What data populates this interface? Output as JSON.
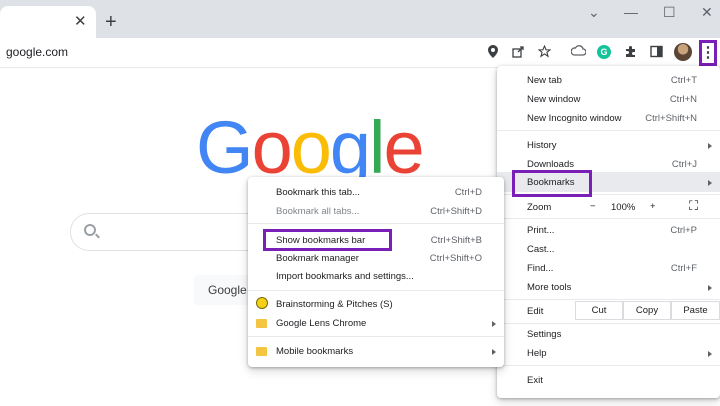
{
  "window": {
    "tab_close": "✕",
    "new_tab": "+",
    "controls": {
      "dropdown": "⌄",
      "minimize": "—",
      "maximize": "☐",
      "close": "✕"
    }
  },
  "toolbar": {
    "url": "google.com",
    "icons": [
      "location-icon",
      "share-icon",
      "star-icon",
      "extension-cloud-icon",
      "grammarly-icon",
      "puzzle-icon",
      "sidepanel-icon",
      "avatar",
      "kebab-menu-icon"
    ],
    "grammarly_letter": "G",
    "kebab": "⋮"
  },
  "google": {
    "logo_letters": [
      "G",
      "o",
      "o",
      "g",
      "l",
      "e"
    ],
    "logo_colors": [
      "#4285F4",
      "#EA4335",
      "#FBBC05",
      "#4285F4",
      "#34A853",
      "#EA4335"
    ],
    "search_button": "Google"
  },
  "chrome_menu": {
    "new_tab": {
      "label": "New tab",
      "shortcut": "Ctrl+T"
    },
    "new_window": {
      "label": "New window",
      "shortcut": "Ctrl+N"
    },
    "incognito": {
      "label": "New Incognito window",
      "shortcut": "Ctrl+Shift+N"
    },
    "history": {
      "label": "History"
    },
    "downloads": {
      "label": "Downloads",
      "shortcut": "Ctrl+J"
    },
    "bookmarks": {
      "label": "Bookmarks"
    },
    "zoom": {
      "label": "Zoom",
      "minus": "−",
      "value": "100%",
      "plus": "+",
      "fullscreen": "⛶"
    },
    "print": {
      "label": "Print...",
      "shortcut": "Ctrl+P"
    },
    "cast": {
      "label": "Cast..."
    },
    "find": {
      "label": "Find...",
      "shortcut": "Ctrl+F"
    },
    "more_tools": {
      "label": "More tools"
    },
    "edit": {
      "label": "Edit",
      "cut": "Cut",
      "copy": "Copy",
      "paste": "Paste"
    },
    "settings": {
      "label": "Settings"
    },
    "help": {
      "label": "Help"
    },
    "exit": {
      "label": "Exit"
    }
  },
  "bookmarks_menu": {
    "bookmark_tab": {
      "label": "Bookmark this tab...",
      "shortcut": "Ctrl+D"
    },
    "bookmark_all": {
      "label": "Bookmark all tabs...",
      "shortcut": "Ctrl+Shift+D"
    },
    "show_bar": {
      "label": "Show bookmarks bar",
      "shortcut": "Ctrl+Shift+B"
    },
    "manager": {
      "label": "Bookmark manager",
      "shortcut": "Ctrl+Shift+O"
    },
    "import": {
      "label": "Import bookmarks and settings..."
    },
    "brainstorming": {
      "label": "Brainstorming & Pitches (S)"
    },
    "lens": {
      "label": "Google Lens Chrome"
    },
    "mobile": {
      "label": "Mobile bookmarks"
    }
  },
  "colors": {
    "highlight": "#7a1fb8"
  }
}
